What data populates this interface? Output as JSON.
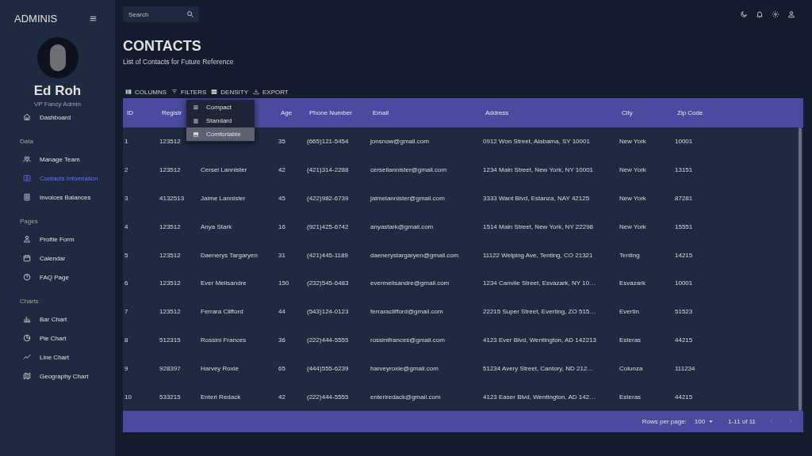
{
  "sidebar": {
    "brand": "ADMINIS",
    "profile": {
      "name": "Ed Roh",
      "role": "VP Fancy Admin"
    },
    "sections": [
      {
        "items": [
          {
            "label": "Dashboard",
            "selected": false
          }
        ]
      },
      {
        "title": "Data",
        "items": [
          {
            "label": "Manage Team",
            "selected": false
          },
          {
            "label": "Contacts Information",
            "selected": true
          },
          {
            "label": "Invoices Balances",
            "selected": false
          }
        ]
      },
      {
        "title": "Pages",
        "items": [
          {
            "label": "Profile Form",
            "selected": false
          },
          {
            "label": "Calendar",
            "selected": false
          },
          {
            "label": "FAQ Page",
            "selected": false
          }
        ]
      },
      {
        "title": "Charts",
        "items": [
          {
            "label": "Bar Chart",
            "selected": false
          },
          {
            "label": "Pie Chart",
            "selected": false
          },
          {
            "label": "Line Chart",
            "selected": false
          },
          {
            "label": "Geography Chart",
            "selected": false
          }
        ]
      }
    ]
  },
  "topbar": {
    "search": {
      "placeholder": "Search"
    }
  },
  "header": {
    "title": "CONTACTS",
    "subtitle": "List of Contacts for Future Reference"
  },
  "toolbar": [
    {
      "label": "COLUMNS"
    },
    {
      "label": "FILTERS"
    },
    {
      "label": "DENSITY"
    },
    {
      "label": "EXPORT"
    }
  ],
  "density_menu": [
    {
      "label": "Compact",
      "selected": false
    },
    {
      "label": "Standard",
      "selected": false
    },
    {
      "label": "Comfortable",
      "selected": true
    }
  ],
  "table": {
    "columns": [
      {
        "label": "ID"
      },
      {
        "label": "Registr"
      },
      {},
      {
        "label": "Age"
      },
      {
        "label": "Phone Number"
      },
      {
        "label": "Email"
      },
      {
        "label": "Address"
      },
      {
        "label": "City"
      },
      {
        "label": "Zip Code"
      }
    ],
    "rows": [
      {
        "cells": [
          "1",
          "123512",
          null,
          "35",
          "(665)121-5454",
          "jonsnow@gmail.com",
          "0912 Won Street, Alabama, SY 10001",
          "New York",
          "10001"
        ]
      },
      {
        "cells": [
          "2",
          "123512",
          "Cersei Lannister",
          "42",
          "(421)314-2288",
          "cerseilannister@gmail.com",
          "1234 Main Street, New York, NY 10001",
          "New York",
          "13151"
        ]
      },
      {
        "cells": [
          "3",
          "4132513",
          "Jaime Lannister",
          "45",
          "(422)982-6739",
          "jaimelannister@gmail.com",
          "3333 Want Blvd, Estanza, NAY 42125",
          "New York",
          "87281"
        ]
      },
      {
        "cells": [
          "4",
          "123512",
          "Anya Stark",
          "16",
          "(921)425-6742",
          "anyastark@gmail.com",
          "1514 Main Street, New York, NY 22298",
          "New York",
          "15551"
        ]
      },
      {
        "cells": [
          "5",
          "123512",
          "Daenerys Targaryen",
          "31",
          "(421)445-1189",
          "daenerystargaryen@gmail.com",
          "11122 Welping Ave, Tenting, CO 21321",
          "Tenting",
          "14215"
        ]
      },
      {
        "cells": [
          "6",
          "123512",
          "Ever Melisandre",
          "150",
          "(232)545-6483",
          "evermelisandre@gmail.com",
          "1234 Canvile Street, Esvazark, NY 10…",
          "Esvazark",
          "10001"
        ]
      },
      {
        "cells": [
          "7",
          "123512",
          "Ferrara Clifford",
          "44",
          "(543)124-0123",
          "ferraraclifford@gmail.com",
          "22215 Super Street, Everting, ZO 515…",
          "Evertin",
          "51523"
        ]
      },
      {
        "cells": [
          "8",
          "512315",
          "Rossini Frances",
          "36",
          "(222)444-5555",
          "rossinifrances@gmail.com",
          "4123 Ever Blvd, Wentington, AD 142213",
          "Esteras",
          "44215"
        ]
      },
      {
        "cells": [
          "9",
          "928397",
          "Harvey Roxie",
          "65",
          "(444)555-6239",
          "harveyroxie@gmail.com",
          "51234 Avery Street, Cantory, ND 212…",
          "Colunza",
          "111234"
        ]
      },
      {
        "cells": [
          "10",
          "533215",
          "Enteri Redack",
          "42",
          "(222)444-5555",
          "enteriredack@gmail.com",
          "4123 Easer Blvd, Wentington, AD 142…",
          "Esteras",
          "44215"
        ]
      }
    ],
    "footer": {
      "rows_per_page_label": "Rows per page:",
      "rows_per_page": "100",
      "range": "1-11 of 11"
    }
  }
}
